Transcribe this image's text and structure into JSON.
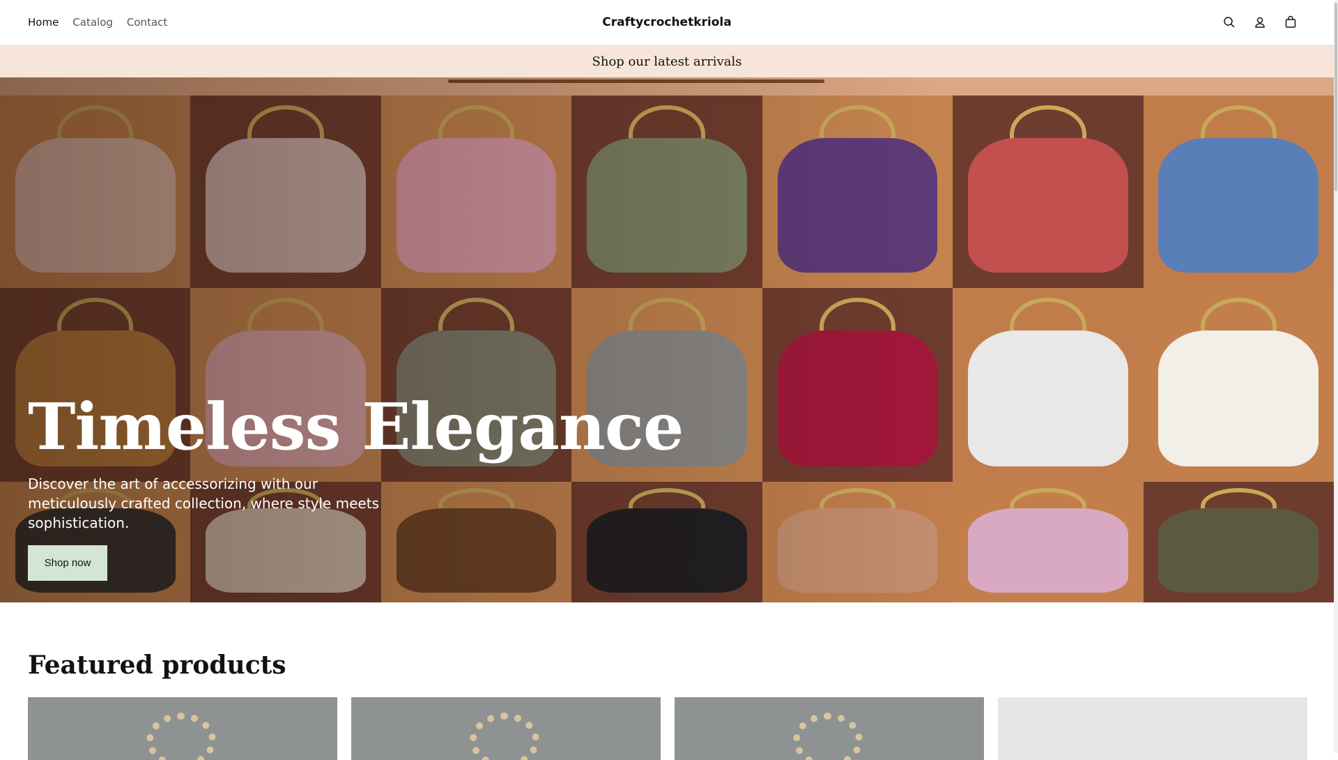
{
  "header": {
    "nav": [
      "Home",
      "Catalog",
      "Contact"
    ],
    "logo": "Craftycrochetkriola",
    "icons": [
      "search-icon",
      "account-icon",
      "cart-icon"
    ]
  },
  "announcement": "Shop our latest arrivals",
  "hero": {
    "title": "Timeless Elegance",
    "subtitle": "Discover the art of accessorizing with our meticulously crafted collection, where style meets sophistication.",
    "button": "Shop now"
  },
  "featured": {
    "title": "Featured products"
  },
  "colors": {
    "button": "#d3e6d4",
    "banner": "#f6e5d8",
    "hero_bg": "#c88a57"
  }
}
